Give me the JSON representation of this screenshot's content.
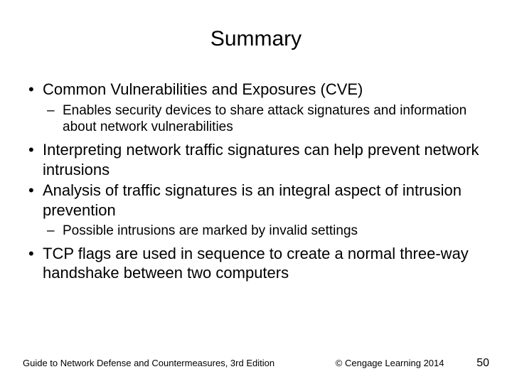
{
  "title": "Summary",
  "bullets": {
    "b1": "Common Vulnerabilities and Exposures (CVE)",
    "b1_1": "Enables security devices to share attack signatures and information about network vulnerabilities",
    "b2": "Interpreting network traffic signatures can help prevent network intrusions",
    "b3": "Analysis of traffic signatures is an integral aspect of intrusion prevention",
    "b3_1": "Possible intrusions are marked by invalid settings",
    "b4": "TCP flags are used in sequence to create a normal three-way handshake between two computers"
  },
  "footer": {
    "left": "Guide to Network Defense and Countermeasures, 3rd Edition",
    "center": "© Cengage Learning 2014",
    "right": "50"
  }
}
